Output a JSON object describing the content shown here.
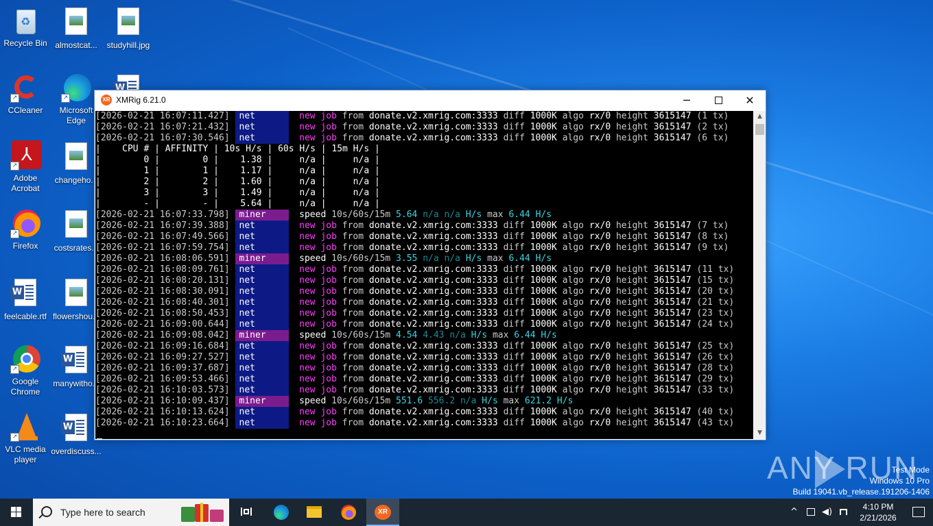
{
  "desktop": {
    "icons": [
      {
        "label": "Recycle Bin"
      },
      {
        "label": "almostcat..."
      },
      {
        "label": "studyhill.jpg"
      },
      {
        "label": "CCleaner"
      },
      {
        "label": "Microsoft Edge"
      },
      {
        "label": "Adobe Acrobat"
      },
      {
        "label": "changeho..."
      },
      {
        "label": "Firefox"
      },
      {
        "label": "costsrates..."
      },
      {
        "label": "feelcable.rtf"
      },
      {
        "label": "flowershou..."
      },
      {
        "label": "Google Chrome"
      },
      {
        "label": "manywitho..."
      },
      {
        "label": "VLC media player"
      },
      {
        "label": "overdiscuss..."
      }
    ]
  },
  "window": {
    "title": "XMRig 6.21.0",
    "minimize": "─",
    "close": "✕",
    "app_icon": "XR"
  },
  "console": {
    "lines": [
      {
        "type": "job",
        "ts": "[2026-02-21 16:07:11.427]",
        "tag": "net",
        "height": "3615147",
        "tx": "(1 tx)"
      },
      {
        "type": "job",
        "ts": "[2026-02-21 16:07:21.432]",
        "tag": "net",
        "height": "3615147",
        "tx": "(2 tx)"
      },
      {
        "type": "job",
        "ts": "[2026-02-21 16:07:30.546]",
        "tag": "net",
        "height": "3615147",
        "tx": "(6 tx)"
      },
      {
        "type": "table",
        "text": "|    CPU # | AFFINITY | 10s H/s | 60s H/s | 15m H/s |"
      },
      {
        "type": "table",
        "text": "|        0 |        0 |    1.38 |     n/a |     n/a |"
      },
      {
        "type": "table",
        "text": "|        1 |        1 |    1.17 |     n/a |     n/a |"
      },
      {
        "type": "table",
        "text": "|        2 |        2 |    1.60 |     n/a |     n/a |"
      },
      {
        "type": "table",
        "text": "|        3 |        3 |    1.49 |     n/a |     n/a |"
      },
      {
        "type": "table",
        "text": "|        - |        - |    5.64 |     n/a |     n/a |"
      },
      {
        "type": "speed",
        "ts": "[2026-02-21 16:07:33.798]",
        "tag": "miner",
        "s10": "5.64",
        "s60": "n/a",
        "s15": "n/a",
        "max": "6.44"
      },
      {
        "type": "job",
        "ts": "[2026-02-21 16:07:39.388]",
        "tag": "net",
        "height": "3615147",
        "tx": "(7 tx)"
      },
      {
        "type": "job",
        "ts": "[2026-02-21 16:07:49.566]",
        "tag": "net",
        "height": "3615147",
        "tx": "(8 tx)"
      },
      {
        "type": "job",
        "ts": "[2026-02-21 16:07:59.754]",
        "tag": "net",
        "height": "3615147",
        "tx": "(9 tx)"
      },
      {
        "type": "speed",
        "ts": "[2026-02-21 16:08:06.591]",
        "tag": "miner",
        "s10": "3.55",
        "s60": "n/a",
        "s15": "n/a",
        "max": "6.44"
      },
      {
        "type": "job",
        "ts": "[2026-02-21 16:08:09.761]",
        "tag": "net",
        "height": "3615147",
        "tx": "(11 tx)"
      },
      {
        "type": "job",
        "ts": "[2026-02-21 16:08:20.131]",
        "tag": "net",
        "height": "3615147",
        "tx": "(15 tx)"
      },
      {
        "type": "job",
        "ts": "[2026-02-21 16:08:30.091]",
        "tag": "net",
        "height": "3615147",
        "tx": "(20 tx)"
      },
      {
        "type": "job",
        "ts": "[2026-02-21 16:08:40.301]",
        "tag": "net",
        "height": "3615147",
        "tx": "(21 tx)"
      },
      {
        "type": "job",
        "ts": "[2026-02-21 16:08:50.453]",
        "tag": "net",
        "height": "3615147",
        "tx": "(23 tx)"
      },
      {
        "type": "job",
        "ts": "[2026-02-21 16:09:00.644]",
        "tag": "net",
        "height": "3615147",
        "tx": "(24 tx)"
      },
      {
        "type": "speed",
        "ts": "[2026-02-21 16:09:08.042]",
        "tag": "miner",
        "s10": "4.54",
        "s60": "4.43",
        "s15": "n/a",
        "max": "6.44"
      },
      {
        "type": "job",
        "ts": "[2026-02-21 16:09:16.684]",
        "tag": "net",
        "height": "3615147",
        "tx": "(25 tx)"
      },
      {
        "type": "job",
        "ts": "[2026-02-21 16:09:27.527]",
        "tag": "net",
        "height": "3615147",
        "tx": "(26 tx)"
      },
      {
        "type": "job",
        "ts": "[2026-02-21 16:09:37.687]",
        "tag": "net",
        "height": "3615147",
        "tx": "(28 tx)"
      },
      {
        "type": "job",
        "ts": "[2026-02-21 16:09:53.466]",
        "tag": "net",
        "height": "3615147",
        "tx": "(29 tx)"
      },
      {
        "type": "job",
        "ts": "[2026-02-21 16:10:03.573]",
        "tag": "net",
        "height": "3615147",
        "tx": "(33 tx)"
      },
      {
        "type": "speed",
        "ts": "[2026-02-21 16:10:09.437]",
        "tag": "miner",
        "s10": "551.6",
        "s60": "556.2",
        "s15": "n/a",
        "max": "621.2"
      },
      {
        "type": "job",
        "ts": "[2026-02-21 16:10:13.624]",
        "tag": "net",
        "height": "3615147",
        "tx": "(40 tx)"
      },
      {
        "type": "job",
        "ts": "[2026-02-21 16:10:23.664]",
        "tag": "net",
        "height": "3615147",
        "tx": "(43 tx)"
      }
    ],
    "job_words": {
      "new": "new",
      "job": "job",
      "from": "from",
      "pool": "donate.v2.xmrig.com:3333",
      "diff_label": "diff",
      "diff": "1000K",
      "algo_label": "algo",
      "algo": "rx/0",
      "height_label": "height"
    },
    "speed_words": {
      "label": "speed",
      "window": "10s/60s/15m",
      "unit": "H/s",
      "max_label": "max"
    },
    "colors": {
      "net_bg": "#0d1a86",
      "miner_bg": "#7b1c8e",
      "new_job": "#ff3dff",
      "speed": "#3ad6e4"
    }
  },
  "watermark": {
    "brand": "ANY RUN",
    "mode": "Test Mode",
    "os": "Windows 10 Pro",
    "build": "Build 19041.vb_release.191206-1406"
  },
  "taskbar": {
    "search_placeholder": "Type here to search",
    "apps": [
      {
        "icon": "task-view-icon"
      },
      {
        "icon": "edge-icon"
      },
      {
        "icon": "file-explorer-icon"
      },
      {
        "icon": "firefox-icon"
      },
      {
        "icon": "xmrig-icon"
      }
    ],
    "time": "4:10 PM",
    "date": "2/21/2026",
    "tray_chevron": "^"
  }
}
